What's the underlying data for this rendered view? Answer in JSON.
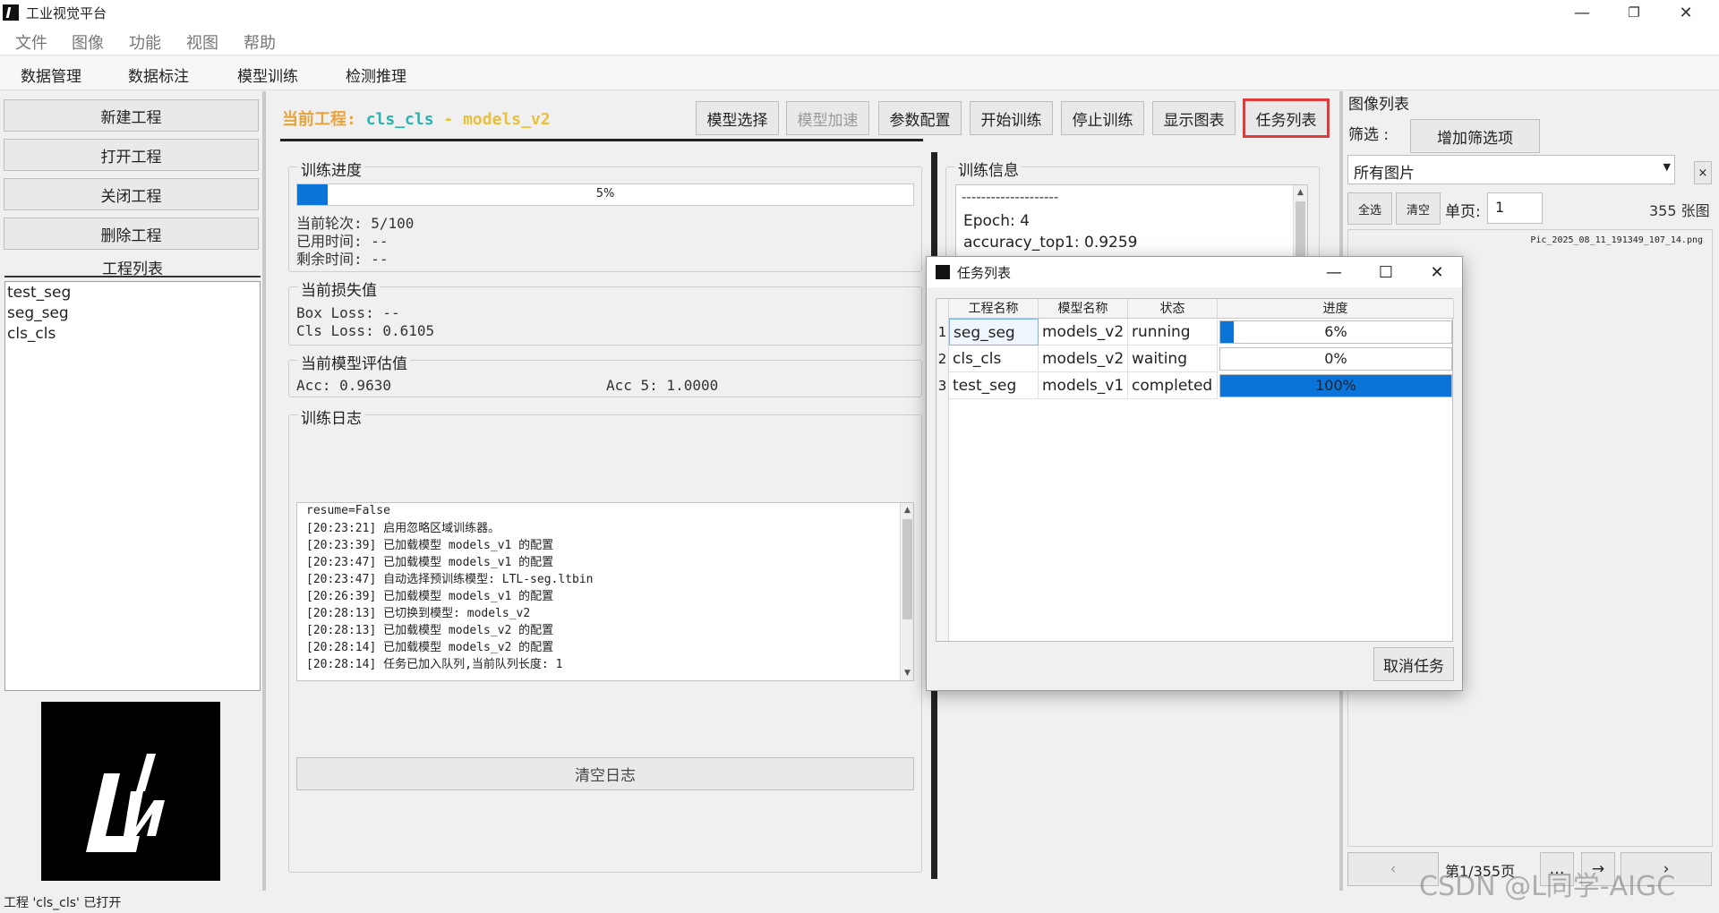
{
  "window": {
    "title": "工业视觉平台",
    "controls": [
      "—",
      "❐",
      "✕"
    ]
  },
  "menu": [
    "文件",
    "图像",
    "功能",
    "视图",
    "帮助"
  ],
  "tabs": [
    "数据管理",
    "数据标注",
    "模型训练",
    "检测推理"
  ],
  "left": {
    "buttons": [
      "新建工程",
      "打开工程",
      "关闭工程",
      "删除工程"
    ],
    "project_list_label": "工程列表",
    "projects": [
      "test_seg",
      "seg_seg",
      "cls_cls"
    ]
  },
  "center": {
    "title_label": "当前工程:",
    "title_project": "cls_cls",
    "title_sep": " - ",
    "title_model": "models_v2",
    "toolbar": [
      {
        "label": "模型选择",
        "enabled": true
      },
      {
        "label": "模型加速",
        "enabled": false
      },
      {
        "label": "参数配置",
        "enabled": true
      },
      {
        "label": "开始训练",
        "enabled": true
      },
      {
        "label": "停止训练",
        "enabled": true
      },
      {
        "label": "显示图表",
        "enabled": true
      },
      {
        "label": "任务列表",
        "enabled": true,
        "highlighted": true
      }
    ],
    "progress_group": {
      "title": "训练进度",
      "progress": 0.05,
      "progress_text": "5%",
      "epoch": "当前轮次: 5/100",
      "elapsed": "已用时间: --",
      "remaining": "剩余时间: --"
    },
    "loss_group": {
      "title": "当前损失值",
      "box_loss": "Box Loss: --",
      "cls_loss": "Cls Loss: 0.6105"
    },
    "eval_group": {
      "title": "当前模型评估值",
      "acc": "Acc: 0.9630",
      "acc5": "Acc 5: 1.0000"
    },
    "log_group": {
      "title": "训练日志",
      "lines": [
        "resume=False",
        "[20:23:21] 启用忽略区域训练器。",
        "[20:23:39] 已加载模型 models_v1 的配置",
        "[20:23:47] 已加载模型 models_v1 的配置",
        "[20:23:47] 自动选择预训练模型: LTL-seg.ltbin",
        "[20:26:39] 已加载模型 models_v1 的配置",
        "[20:28:13] 已切换到模型: models_v2",
        "[20:28:13] 已加载模型 models_v2 的配置",
        "[20:28:14] 已加载模型 models_v2 的配置",
        "[20:28:14] 任务已加入队列,当前队列长度: 1"
      ],
      "clear_button": "清空日志"
    },
    "info_group": {
      "title": "训练信息",
      "lines": [
        "--------------------",
        "Epoch: 4",
        "accuracy_top1: 0.9259"
      ]
    }
  },
  "right": {
    "title": "图像列表",
    "filter_label": "筛选 :",
    "add_filter_button": "增加筛选项",
    "filter_value": "所有图片",
    "clear_filter": "×",
    "select_all": "全选",
    "clear": "清空",
    "per_page_label": "单页:",
    "per_page_value": "1",
    "count": "355  张图",
    "image_name": "Pic_2025_08_11_191349_107_14.png",
    "page_text": "第1/355页",
    "prev": "‹",
    "next": "›",
    "more": "…",
    "go": "→"
  },
  "statusbar": "工程 'cls_cls' 已打开",
  "dialog": {
    "title": "任务列表",
    "controls": [
      "—",
      "☐",
      "✕"
    ],
    "columns": [
      "工程名称",
      "模型名称",
      "状态",
      "进度"
    ],
    "rows": [
      {
        "num": "1",
        "project": "seg_seg",
        "model": "models_v2",
        "status": "running",
        "progress": 0.06,
        "progress_text": "6%"
      },
      {
        "num": "2",
        "project": "cls_cls",
        "model": "models_v2",
        "status": "waiting",
        "progress": 0.0,
        "progress_text": "0%"
      },
      {
        "num": "3",
        "project": "test_seg",
        "model": "models_v1",
        "status": "completed",
        "progress": 1.0,
        "progress_text": "100%"
      }
    ],
    "cancel_button": "取消任务"
  },
  "watermark": "CSDN @L同学-AIGC",
  "colors": {
    "accent": "#0a74d9",
    "highlight_border": "#e03a3a",
    "title_label": "#e8a33a",
    "title_project": "#2ab3b1",
    "title_model": "#e8c03a"
  }
}
